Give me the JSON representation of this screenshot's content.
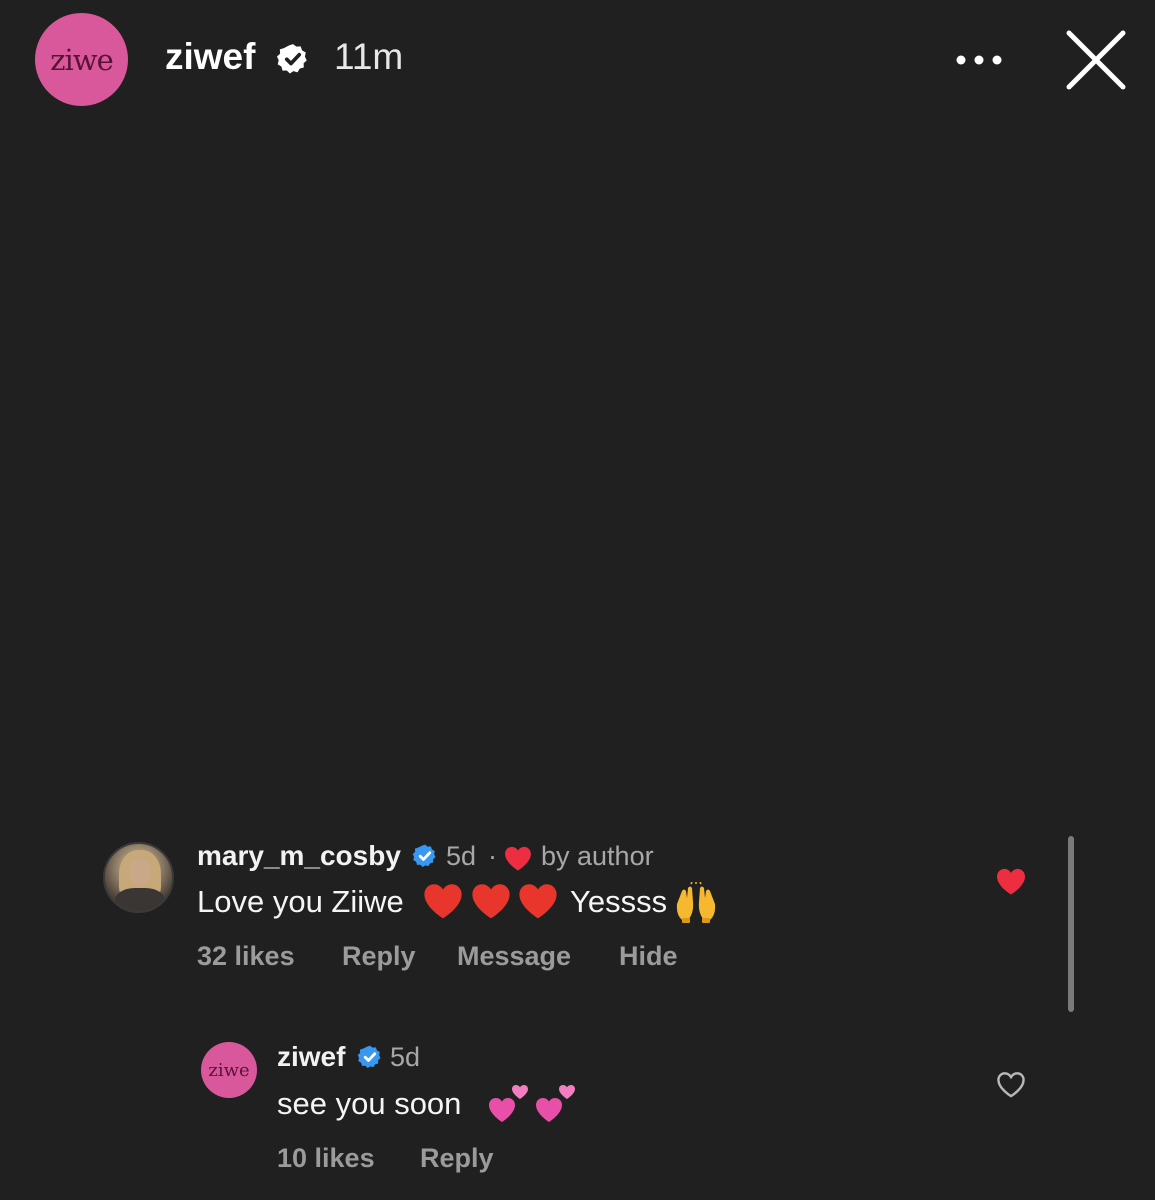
{
  "story": {
    "avatar_text": "ziwe",
    "username": "ziwef",
    "time": "11m"
  },
  "icons": {
    "verified": "verified-badge-icon",
    "more": "more-dots-icon",
    "close": "close-icon",
    "like": "heart-icon"
  },
  "colors": {
    "background": "#202020",
    "avatar_pink": "#d9589c",
    "verified_blue": "#3897f0",
    "like_red": "#ed2e41",
    "muted_text": "#9b9b9b"
  },
  "comments": [
    {
      "username": "mary_m_cosby",
      "time": "5d",
      "separator": "·",
      "liked_by_author": "by author",
      "text_before": "Love you Ziiwe",
      "text_after": "Yessss",
      "likes": "32 likes",
      "actions": [
        "Reply",
        "Message",
        "Hide"
      ],
      "liked": true
    },
    {
      "avatar_text": "ziwe",
      "username": "ziwef",
      "time": "5d",
      "text": "see you soon",
      "likes": "10 likes",
      "actions": [
        "Reply"
      ],
      "liked": false
    }
  ]
}
